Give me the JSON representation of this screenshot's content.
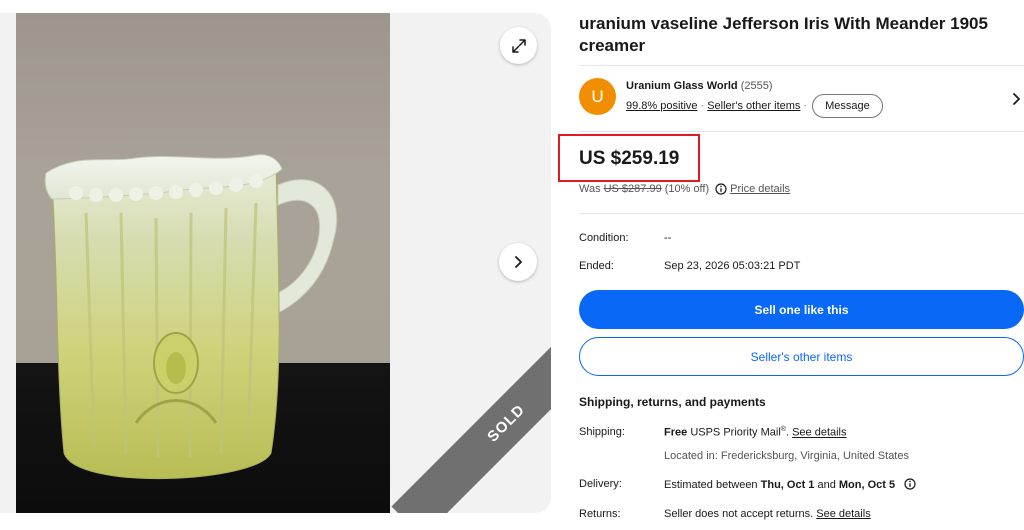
{
  "gallery": {
    "expand_icon": "expand-icon",
    "next_icon": "chevron-right-icon",
    "sold_label": "SOLD"
  },
  "listing": {
    "title": "uranium vaseline Jefferson Iris With Meander 1905 creamer"
  },
  "seller": {
    "avatar_letter": "U",
    "avatar_color": "#f18e00",
    "name": "Uranium Glass World",
    "feedback_count": "(2555)",
    "positive": "99.8% positive",
    "separator": "·",
    "other_items_link": "Seller's other items",
    "message_button": "Message",
    "chevron_icon": "chevron-right-icon"
  },
  "price": {
    "current": "US $259.19",
    "was_label": "Was",
    "was_price": "US $287.99",
    "discount": "(10% off)",
    "info_icon": "info-icon",
    "details_link": "Price details",
    "highlight_color": "#e21b22"
  },
  "details": {
    "condition_label": "Condition:",
    "condition_value": "--",
    "ended_label": "Ended:",
    "ended_value": "Sep 23, 2026 05:03:21 PDT"
  },
  "actions": {
    "sell_one": "Sell one like this",
    "sellers_other_items": "Seller's other items",
    "accent_color": "#0968f6"
  },
  "shipping": {
    "section_title": "Shipping, returns, and payments",
    "shipping_label": "Shipping:",
    "shipping_free": "Free",
    "shipping_service": "USPS Priority Mail",
    "shipping_reg": "®",
    "shipping_link": "See details",
    "located_in": "Located in: Fredericksburg, Virginia, United States",
    "delivery_label": "Delivery:",
    "delivery_prefix": "Estimated between",
    "delivery_start": "Thu, Oct 1",
    "delivery_and": "and",
    "delivery_end": "Mon, Oct 5",
    "returns_label": "Returns:",
    "returns_text": "Seller does not accept returns.",
    "returns_link": "See details"
  }
}
